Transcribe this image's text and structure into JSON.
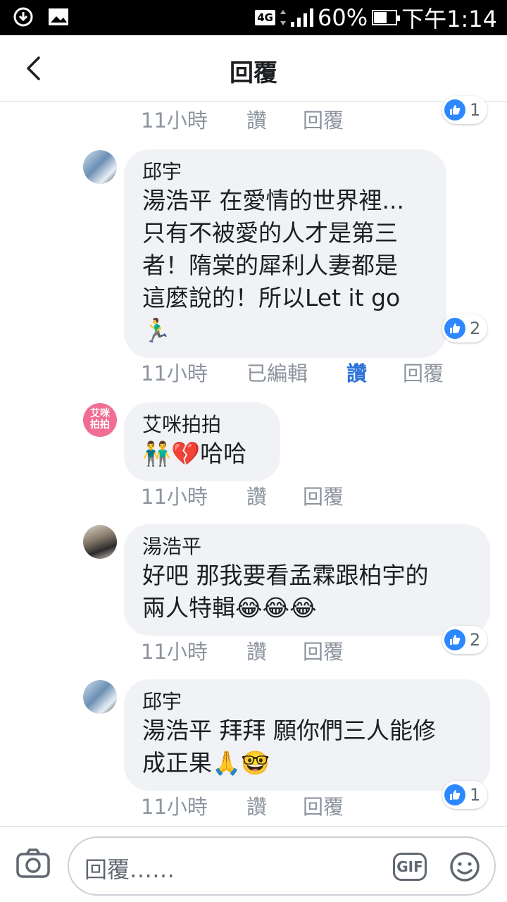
{
  "status_bar": {
    "network": "4G",
    "battery": "60%",
    "time": "下午1:14"
  },
  "header": {
    "title": "回覆"
  },
  "top_meta": {
    "time": "11小時",
    "like": "讚",
    "reply": "回覆",
    "reaction_count": "1"
  },
  "comments": [
    {
      "author": "邱宇",
      "lines": [
        "湯浩平 在愛情的世界裡...",
        "只有不被愛的人才是第三",
        "者！隋棠的犀利人妻都是",
        "這麼說的！所以Let it go",
        "🏃‍♂️"
      ],
      "time": "11小時",
      "edited": "已編輯",
      "like": "讚",
      "reply": "回覆",
      "reaction_count": "2"
    },
    {
      "author": "艾咪拍拍",
      "avatar_text": "艾咪拍拍",
      "lines": [
        "👬💔哈哈"
      ],
      "time": "11小時",
      "like": "讚",
      "reply": "回覆"
    },
    {
      "author": "湯浩平",
      "lines": [
        "好吧 那我要看孟霖跟柏宇的",
        "兩人特輯😂😂😂"
      ],
      "time": "11小時",
      "like": "讚",
      "reply": "回覆",
      "reaction_count": "2"
    },
    {
      "author": "邱宇",
      "lines": [
        "湯浩平 拜拜 願你們三人能修",
        "成正果🙏🤓"
      ],
      "time": "11小時",
      "like": "讚",
      "reply": "回覆",
      "reaction_count": "1"
    }
  ],
  "composer": {
    "placeholder": "回覆……",
    "gif_label": "GIF"
  },
  "colors": {
    "bubble": "#f0f2f5",
    "like_active": "#2d72d9",
    "reaction_blue": "#2d88ff",
    "meta_gray": "#8d949e"
  }
}
